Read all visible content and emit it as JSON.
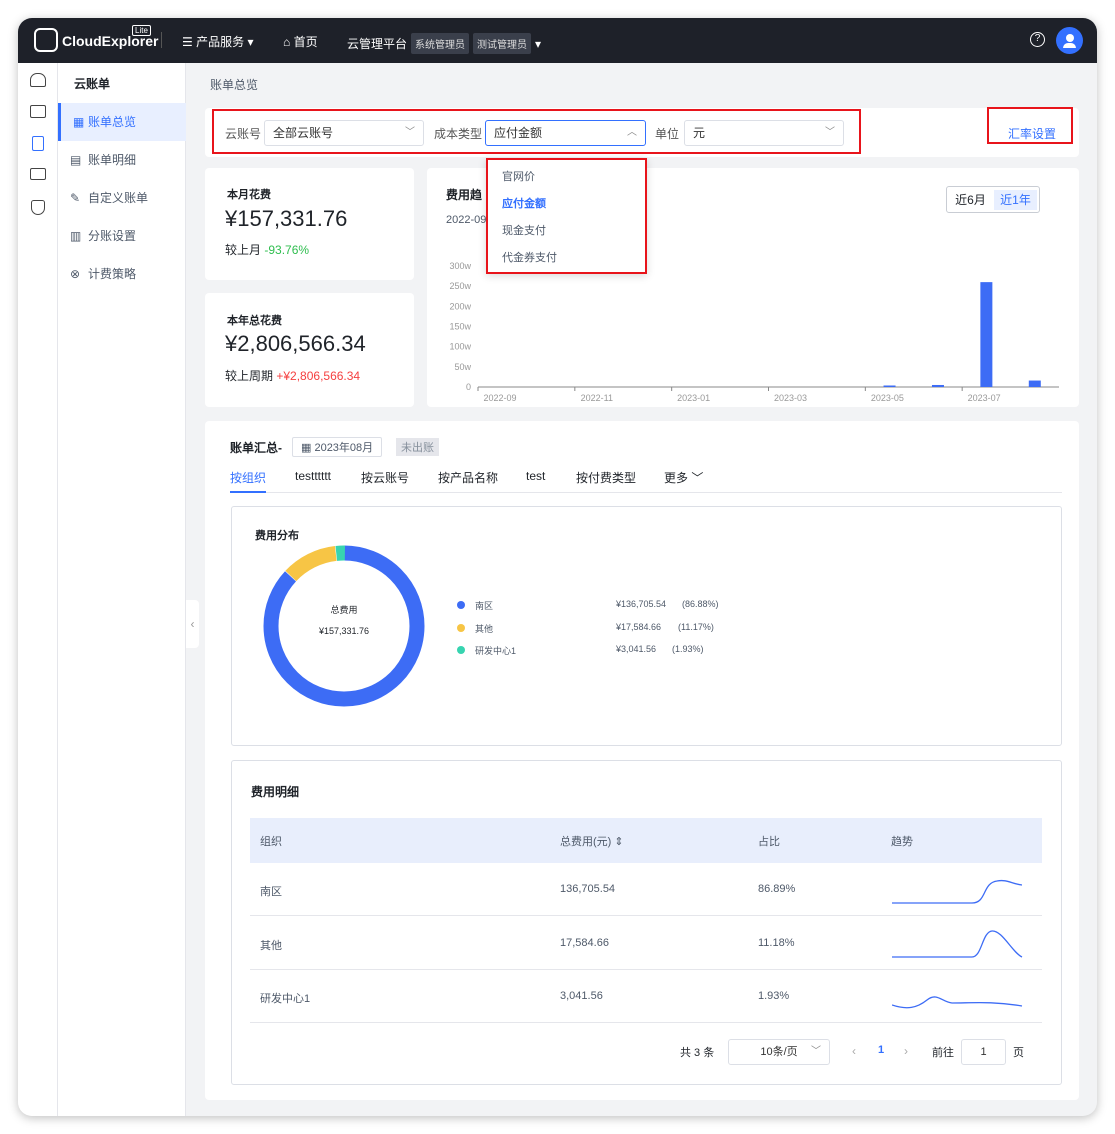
{
  "app": {
    "logo": "CloudExplorer",
    "badge": "Lite"
  },
  "topbar": {
    "products": "产品服务",
    "home": "首页",
    "platform": "云管理平台",
    "role_tags": [
      "系统管理员",
      "测试管理员"
    ]
  },
  "rail_icons": [
    "users-icon",
    "server-icon",
    "bill-icon",
    "monitor-icon",
    "shield-icon"
  ],
  "submenu": {
    "title": "云账单",
    "items": [
      {
        "label": "账单总览",
        "icon": "grid-icon",
        "active": true
      },
      {
        "label": "账单明细",
        "icon": "document-icon"
      },
      {
        "label": "自定义账单",
        "icon": "edit-icon"
      },
      {
        "label": "分账设置",
        "icon": "split-icon"
      },
      {
        "label": "计费策略",
        "icon": "policy-icon"
      }
    ]
  },
  "breadcrumb": "账单总览",
  "filters": {
    "account_label": "云账号",
    "account_value": "全部云账号",
    "cost_label": "成本类型",
    "cost_value": "应付金额",
    "unit_label": "单位",
    "unit_value": "元",
    "rate_link": "汇率设置"
  },
  "cost_dropdown": {
    "options": [
      "官网价",
      "应付金额",
      "现金支付",
      "代金券支付"
    ],
    "selected": "应付金额"
  },
  "month_card": {
    "title": "本月花费",
    "value": "¥157,331.76",
    "compare_label": "较上月",
    "compare_value": "-93.76%",
    "compare_color": "#2ebd4e"
  },
  "year_card": {
    "title": "本年总花费",
    "value": "¥2,806,566.34",
    "compare_label": "较上周期",
    "compare_value": "+¥2,806,566.34",
    "compare_color": "#f53f3f"
  },
  "trend": {
    "title": "费用趋",
    "subtitle": "2022-09",
    "ranges": [
      "近6月",
      "近1年"
    ],
    "active_range": "近1年"
  },
  "chart_data": {
    "type": "bar",
    "categories": [
      "2022-09",
      "2022-10",
      "2022-11",
      "2022-12",
      "2023-01",
      "2023-02",
      "2023-03",
      "2023-04",
      "2023-05",
      "2023-06",
      "2023-07",
      "2023-08"
    ],
    "tick_labels": [
      "2022-09",
      "2022-11",
      "2023-01",
      "2023-03",
      "2023-05",
      "2023-07"
    ],
    "values": [
      0,
      0,
      0,
      0,
      0,
      0,
      0,
      0,
      1,
      5,
      260,
      16
    ],
    "unit": "w",
    "ylim": [
      0,
      300
    ],
    "yticks": [
      "0",
      "50w",
      "100w",
      "150w",
      "200w",
      "250w",
      "300w"
    ],
    "color": "#3d6cf5"
  },
  "summary": {
    "title": "账单汇总-",
    "month": "2023年08月",
    "status": "未出账",
    "tabs": [
      "按组织",
      "testttttt",
      "按云账号",
      "按产品名称",
      "test",
      "按付费类型",
      "更多"
    ],
    "active_tab": "按组织"
  },
  "distribution": {
    "title": "费用分布",
    "center_label": "总费用",
    "center_value": "¥157,331.76",
    "items": [
      {
        "name": "南区",
        "amount": "¥136,705.54",
        "pct": "(86.88%)",
        "value": 86.88,
        "color": "#3d6cf5"
      },
      {
        "name": "其他",
        "amount": "¥17,584.66",
        "pct": "(11.17%)",
        "value": 11.17,
        "color": "#f7c545"
      },
      {
        "name": "研发中心1",
        "amount": "¥3,041.56",
        "pct": "(1.93%)",
        "value": 1.93,
        "color": "#37d4b0"
      }
    ]
  },
  "detail": {
    "title": "费用明细",
    "columns": [
      "组织",
      "总费用(元)",
      "占比",
      "趋势"
    ],
    "rows": [
      {
        "org": "南区",
        "total": "136,705.54",
        "pct": "86.89%"
      },
      {
        "org": "其他",
        "total": "17,584.66",
        "pct": "11.18%"
      },
      {
        "org": "研发中心1",
        "total": "3,041.56",
        "pct": "1.93%"
      }
    ]
  },
  "pagination": {
    "total": "共 3 条",
    "page_size": "10条/页",
    "current": "1",
    "goto_label": "前往",
    "goto_value": "1",
    "page_suffix": "页"
  }
}
